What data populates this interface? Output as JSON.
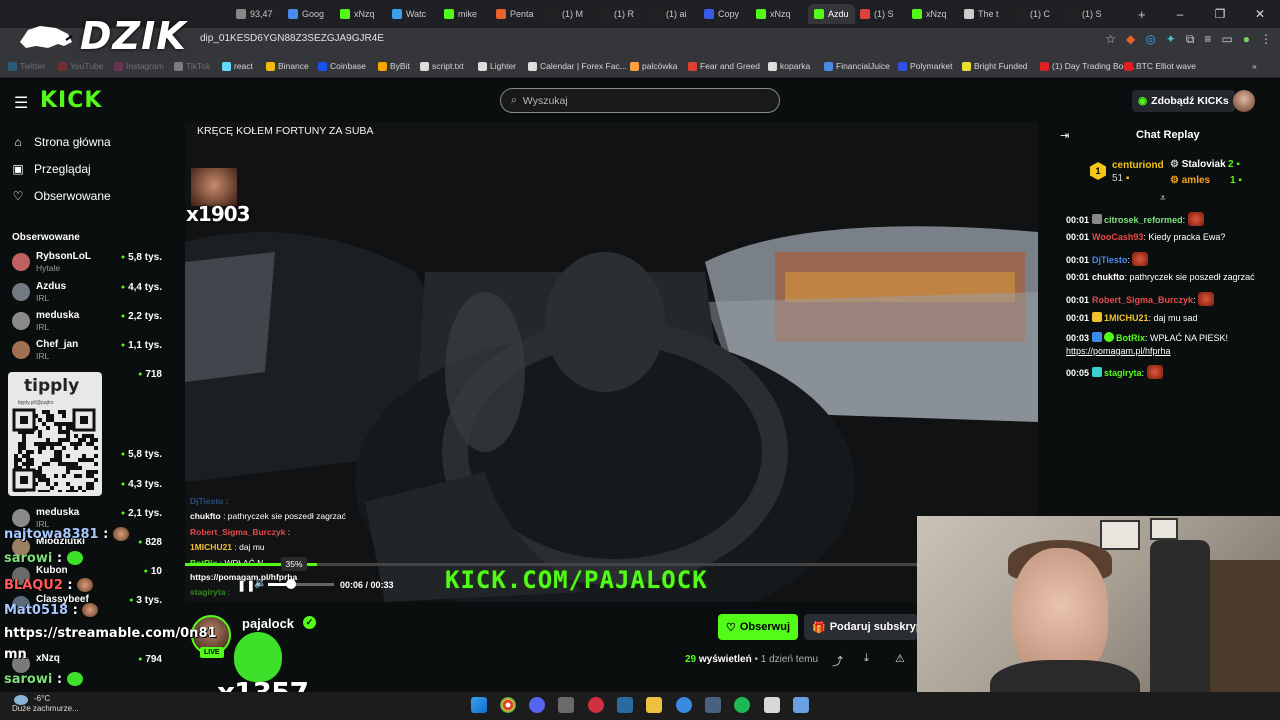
{
  "browser": {
    "tabs": [
      "93,47",
      "Goog",
      "xNzq",
      "Watc",
      "mike",
      "Penta",
      "(1) M",
      "(1) R",
      "(1) ai",
      "Copy",
      "xNzq",
      "Azdu",
      "(1) S",
      "xNzq",
      "The t",
      "(1) C",
      "(1) S"
    ],
    "url": "dip_01KESD6YGN88Z3SEZGJA9GJR4E",
    "bookmarks": [
      "Twitter",
      "YouTube",
      "Instagram",
      "TikTok",
      "react",
      "Binance",
      "Coinbase",
      "ByBit",
      "script.txt",
      "Lighter",
      "Calendar | Forex Fac...",
      "palcówka",
      "Fear and Greed",
      "koparka",
      "FinancialJuice",
      "Polymarket",
      "Bright Funded",
      "(1) Day Trading Boo...",
      "BTC Elliot wave"
    ]
  },
  "overlay": {
    "dzik": "DZIK",
    "x1903": "x1903",
    "x1357": "x1357",
    "chat": [
      {
        "user": "najtowa8381",
        "text": ":"
      },
      {
        "user": "sarowi",
        "text": ":"
      },
      {
        "user": "BLAQU2",
        "text": ":"
      },
      {
        "user": "Mat0518",
        "text": ":"
      },
      {
        "user": "https://streamable.com/0n81",
        "text": ""
      },
      {
        "user": "mn",
        "text": ""
      },
      {
        "user": "sarowi",
        "text": ":"
      }
    ]
  },
  "kick": {
    "logo": "KICK",
    "search_placeholder": "Wyszukaj",
    "kicks_button": "Zdobądź KICKs"
  },
  "sidebar": {
    "nav": [
      "Strona główna",
      "Przeglądaj",
      "Obserwowane"
    ],
    "followed_label": "Obserwowane",
    "followed": [
      {
        "name": "RybsonLoL",
        "category": "Hytale",
        "viewers": "5,8 tys."
      },
      {
        "name": "Azdus",
        "category": "IRL",
        "viewers": "4,4 tys."
      },
      {
        "name": "meduska",
        "category": "IRL",
        "viewers": "2,2 tys."
      },
      {
        "name": "Chef_jan",
        "category": "IRL",
        "viewers": "1,1 tys."
      },
      {
        "name": "",
        "category": "",
        "viewers": "718"
      },
      {
        "name": "",
        "category": "",
        "viewers": "5,8 tys."
      },
      {
        "name": "",
        "category": "",
        "viewers": "4,3 tys."
      },
      {
        "name": "meduska",
        "category": "IRL",
        "viewers": "2,1 tys."
      },
      {
        "name": "Mlodziutki",
        "category": "",
        "viewers": "828"
      },
      {
        "name": "Kubon",
        "category": "",
        "viewers": "10"
      },
      {
        "name": "Classybeef",
        "category": "",
        "viewers": "3 tys."
      },
      {
        "name": "xNzq",
        "category": "",
        "viewers": "794"
      }
    ],
    "tipply": {
      "title": "tipply",
      "url": "tipply.pl/@pajtro"
    }
  },
  "video": {
    "title": "KRĘCĘ KOŁEM FORTUNY ZA SUBA",
    "banner": "KICK.COM/PAJALOCK",
    "progress": 0.18,
    "volume_label": "35%",
    "volume": 0.35,
    "time_current": "00:06",
    "time_total": "00:33",
    "chat_lines": [
      {
        "user": "DjTiesto",
        "text": ":"
      },
      {
        "user": "chukfto",
        "text": ": pathryczek sie poszedł zagrzać"
      },
      {
        "user": "Robert_Sigma_Burczyk",
        "text": ":"
      },
      {
        "user": "1MICHU21",
        "text": ": daj mu"
      },
      {
        "user": "BotRix",
        "text": ": WPŁAĆ N"
      },
      {
        "user": "https://pomagam.pl/hfprha",
        "text": ""
      },
      {
        "user": "stagiryta",
        "text": ":"
      }
    ]
  },
  "channel": {
    "name": "pajalock",
    "live": "LIVE",
    "follow": "Obserwuj",
    "subscribe": "Podaruj subskryp",
    "views_count": "29",
    "views_label": "wyświetleń",
    "age": "• 1 dzień temu"
  },
  "chat": {
    "title": "Chat Replay",
    "leaderboard": [
      {
        "rank": "1",
        "name": "centuriond",
        "count": "51"
      },
      {
        "rank": "",
        "name": "Staloviak",
        "count": "2"
      },
      {
        "rank": "",
        "name": "amles",
        "count": "1"
      }
    ],
    "messages": [
      {
        "time": "00:01",
        "user": "citrosek_reformed",
        "color": "#7ee07a",
        "text": ":"
      },
      {
        "time": "00:01",
        "user": "WooCash93",
        "color": "#e84a4a",
        "text": ": Kiedy pracka Ewa?"
      },
      {
        "time": "00:01",
        "user": "DjTiesto",
        "color": "#4a8ae8",
        "text": ":"
      },
      {
        "time": "00:01",
        "user": "chukfto",
        "color": "#ffffff",
        "text": ": pathryczek sie poszedł zagrzać"
      },
      {
        "time": "00:01",
        "user": "Robert_Sigma_Burczyk",
        "color": "#e84a4a",
        "text": ":"
      },
      {
        "time": "00:01",
        "user": "1MICHU21",
        "color": "#f0c030",
        "text": ": daj mu sad"
      },
      {
        "time": "00:03",
        "user": "BotRix",
        "color": "#53fc18",
        "text": ": WPŁAĆ NA PIESK!"
      },
      {
        "time": "",
        "user": "",
        "color": "#ffffff",
        "text": "https://pomagam.pl/hfprha"
      },
      {
        "time": "00:05",
        "user": "stagiryta",
        "color": "#53fc18",
        "text": ":"
      }
    ]
  },
  "taskbar": {
    "weather_temp": "-6°C",
    "weather_desc": "Duże zachmurze..."
  }
}
